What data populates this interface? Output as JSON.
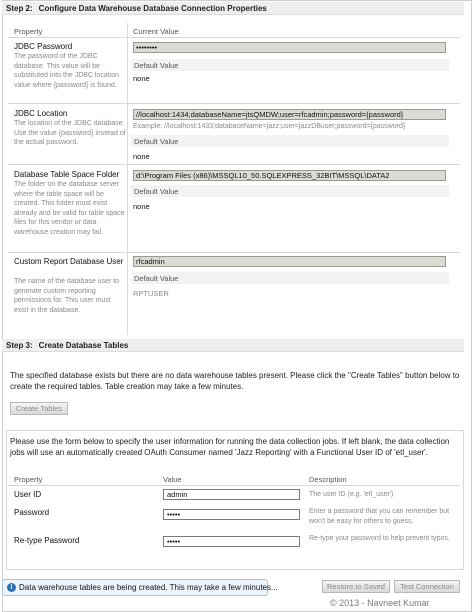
{
  "step2": {
    "number": "Step 2:",
    "title": "Configure Data Warehouse Database Connection Properties",
    "col_property": "Property",
    "col_current": "Current Value",
    "default_label": "Default Value",
    "properties": [
      {
        "name": "JDBC Password",
        "desc": "The password of the JDBC database. This value will be substituted into the JDBC location value where {password} is found.",
        "current": "••••••••",
        "example": "",
        "default": "none"
      },
      {
        "name": "JDBC Location",
        "desc": "The location of the JDBC database. Use the value {password} instead of the actual password.",
        "current": "//localhost:1434;databaseName=jtsQMDW;user=rfcadmin;password={password}",
        "example": "Example: //localhost:1433;databaseName=jazz;user=jazzDBuser;password={password}",
        "default": "none"
      },
      {
        "name": "Database Table Space Folder",
        "desc": "The folder on the database server where the table space will be created. This folder must exist already and be valid for table space files for this vendor or data warehouse creation may fail.",
        "current": "d:\\Program Files (x86)\\MSSQL10_50.SQLEXPRESS_32BIT\\MSSQL\\DATA2",
        "example": "",
        "default": "none"
      },
      {
        "name": "Custom Report Database User",
        "desc": "The name of the database user to generate custom reporting permissions for. This user must exist in the database.",
        "current": "rfcadmin",
        "example": "",
        "default": "RPTUSER"
      }
    ]
  },
  "step3": {
    "number": "Step 3:",
    "title": "Create Database Tables",
    "message": "The specified database exists but there are no data warehouse tables present. Please click the \"Create Tables\" button below to create the required tables. Table creation may take a few minutes.",
    "create_button": "Create Tables"
  },
  "user_form": {
    "intro": "Please use the form below to specify the user information for running the data collection jobs. If left blank, the data collection jobs will use an automatically created OAuth Consumer named 'Jazz Reporting' with a Functional User ID of 'etl_user'.",
    "col_property": "Property",
    "col_value": "Value",
    "col_description": "Description",
    "rows": [
      {
        "label": "User ID",
        "value": "admin",
        "desc": "The user ID (e.g. 'etl_user')"
      },
      {
        "label": "Password",
        "value": "•••••",
        "desc": "Enter a password that you can remember but won't be easy for others to guess."
      },
      {
        "label": "Re-type Password",
        "value": "•••••",
        "desc": "Re-type your password to help prevent typos."
      }
    ]
  },
  "status": {
    "icon": "info-icon",
    "message": "Data warehouse tables are being created. This may take a few minutes..."
  },
  "footer": {
    "restore_button": "Restore to Saved",
    "test_button": "Test Connection",
    "watermark": "© 2013 - Navneet Kumar"
  }
}
